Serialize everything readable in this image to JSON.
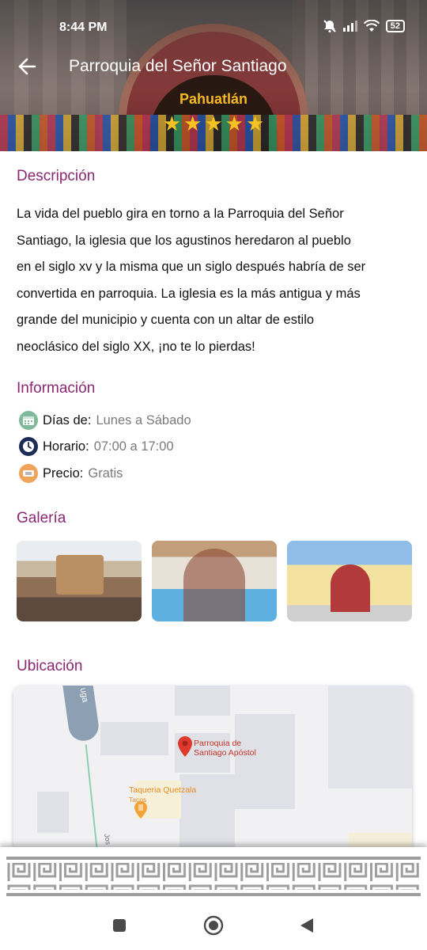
{
  "status_bar": {
    "time": "8:44 PM",
    "battery": "52"
  },
  "header": {
    "title": "Parroquia del Señor Santiago",
    "subtitle": "Pahuatlán",
    "rating_stars": 5
  },
  "description": {
    "heading": "Descripción",
    "lines": [
      "La vida del pueblo gira en torno a la Parroquia del Señor",
      "Santiago, la iglesia que los agustinos heredaron al pueblo",
      "en el siglo xv y la misma que un siglo después habría de ser",
      "convertida en parroquia. La iglesia es la más antigua y más",
      "grande del municipio y cuenta con un altar de estilo",
      "neoclásico del siglo XX, ¡no te lo pierdas!"
    ]
  },
  "information": {
    "heading": "Información",
    "items": [
      {
        "key": "Días de:",
        "value": "Lunes a Sábado",
        "icon": "calendar-icon",
        "color": "#7fb89a"
      },
      {
        "key": "Horario:",
        "value": "07:00 a 17:00",
        "icon": "clock-icon",
        "color": "#1d2b57"
      },
      {
        "key": "Precio:",
        "value": "Gratis",
        "icon": "ticket-icon",
        "color": "#f0a45a"
      }
    ]
  },
  "gallery": {
    "heading": "Galería",
    "images": [
      "gallery-image-1",
      "gallery-image-2",
      "gallery-image-3"
    ]
  },
  "location": {
    "heading": "Ubicación",
    "map": {
      "road_label": "uga",
      "path_label": "Jos",
      "places": [
        {
          "name_line1": "Parroquia de",
          "name_line2": "Santiago Apóstol",
          "type": "red-pin"
        },
        {
          "name_line1": "Taqueria Quetzala",
          "name_line2": "Tacos",
          "type": "food-pin"
        }
      ]
    }
  },
  "colors": {
    "accent": "#8a2873",
    "star": "#f5c321",
    "subtitle": "#f5b921"
  }
}
